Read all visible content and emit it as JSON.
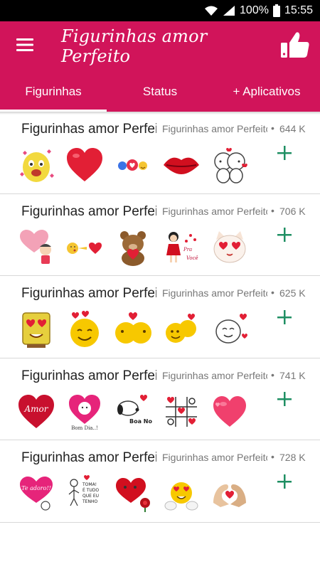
{
  "status_bar": {
    "battery_percent": "100%",
    "time": "15:55"
  },
  "app_bar": {
    "title": "Figurinhas amor Perfeito",
    "menu_icon": "hamburger-menu-icon",
    "like_icon": "thumbs-up-icon"
  },
  "colors": {
    "primary": "#d1145a",
    "add_green": "#1f8f63"
  },
  "tabs": [
    {
      "label": "Figurinhas",
      "active": true
    },
    {
      "label": "Status",
      "active": false
    },
    {
      "label": "+ Aplicativos",
      "active": false
    }
  ],
  "packs": [
    {
      "name": "Figurinhas amor Perfeito",
      "publisher": "Figurinhas amor Perfeito",
      "dot": "•",
      "size": "644 K",
      "stickers": [
        "cartoon-love-sticker",
        "red-heart-sticker",
        "reactions-sticker",
        "red-lips-kiss-sticker",
        "bears-kiss-sticker"
      ]
    },
    {
      "name": "Figurinhas amor Perfeito",
      "publisher": "Figurinhas amor Perfeito",
      "dot": "•",
      "size": "706 K",
      "stickers": [
        "girl-holding-heart-sticker",
        "kiss-emoji-heart-sticker",
        "teddy-bear-hearts-sticker",
        "girl-pra-voce-sticker",
        "cat-heart-eyes-sticker"
      ]
    },
    {
      "name": "Figurinhas amor Perfeito",
      "publisher": "Figurinhas amor Perfeito",
      "dot": "•",
      "size": "625 K",
      "stickers": [
        "sponge-hearts-sticker",
        "smiley-hearts-sticker",
        "smileys-kissing-sticker",
        "smileys-hug-sticker",
        "doodle-face-hearts-sticker"
      ]
    },
    {
      "name": "Figurinhas amor Perfeito",
      "publisher": "Figurinhas amor Perfeito",
      "dot": "•",
      "size": "741 K",
      "stickers": [
        "amor-heart-sticker",
        "bom-dia-cat-heart-sticker",
        "snoopy-boa-noite-sticker",
        "tic-tac-toe-hearts-sticker",
        "pink-hearts-sticker"
      ]
    },
    {
      "name": "Figurinhas amor Perfeito",
      "publisher": "Figurinhas amor Perfeito",
      "dot": "•",
      "size": "728 K",
      "stickers": [
        "te-adoro-sticker",
        "toma-e-tudo-que-eu-tenho-sticker",
        "heart-roses-sticker",
        "emoji-hearts-sticker",
        "hands-heart-sticker"
      ]
    }
  ],
  "sticker_texts": {
    "bom_dia": "Bom Dia..!",
    "boa_noite": "Boa Noite!",
    "amor": "Amor",
    "te_adoro": "Te adoro!!",
    "pra": "Pra",
    "voce": "Você",
    "toma": "TOMA!",
    "e_tudo": "É TUDO",
    "que_eu": "QUE EU",
    "tenho": "TENHO"
  }
}
